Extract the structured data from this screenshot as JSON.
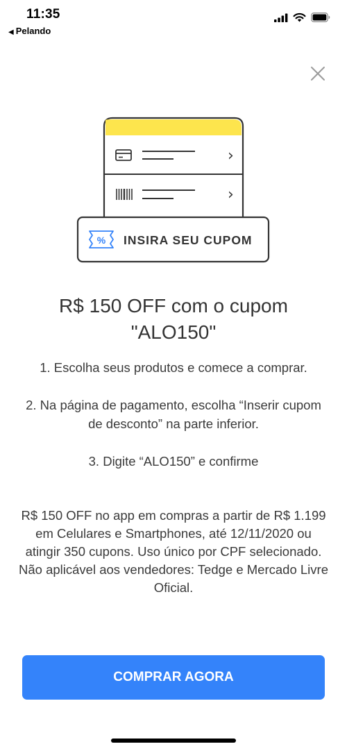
{
  "status_bar": {
    "time": "11:35",
    "back_app": "Pelando",
    "back_arrow": "◀"
  },
  "illustration": {
    "coupon_label": "INSIRA SEU CUPOM",
    "coupon_icon": "%",
    "chevron": "›",
    "accent_color": "#fde54d",
    "stroke_color": "#333333",
    "coupon_icon_color": "#3483fa"
  },
  "headline": "R$ 150 OFF com o cupom \"ALO150\"",
  "steps": [
    "1. Escolha seus produtos e comece a comprar.",
    "2. Na página de pagamento, escolha “Inserir cupom de desconto” na parte inferior.",
    "3. Digite “ALO150” e confirme"
  ],
  "terms": "R$ 150 OFF no app em compras a partir de R$ 1.199 em Celulares e Smartphones, até 12/11/2020 ou atingir 350 cupons. Uso único por CPF selecionado. Não aplicável aos vendedores: Tedge e Mercado Livre Oficial.",
  "cta": {
    "label": "COMPRAR AGORA",
    "color": "#3483fa"
  }
}
